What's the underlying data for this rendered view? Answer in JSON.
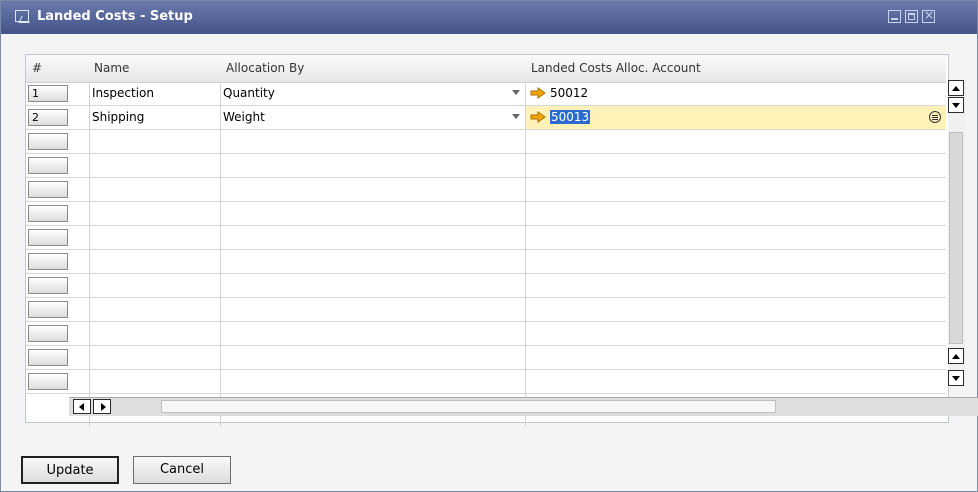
{
  "window": {
    "title": "Landed Costs - Setup"
  },
  "table": {
    "columns": [
      "#",
      "Name",
      "Allocation By",
      "Landed Costs Alloc. Account"
    ],
    "rows": [
      {
        "num": "1",
        "name": "Inspection",
        "allocation_by": "Quantity",
        "account": "50012"
      },
      {
        "num": "2",
        "name": "Shipping",
        "allocation_by": "Weight",
        "account": "50013"
      }
    ]
  },
  "buttons": {
    "update": "Update",
    "cancel": "Cancel"
  },
  "colors": {
    "titlebar": "#4b5f96",
    "selected_row": "#fff1b8",
    "selection": "#2c6ad0",
    "arrow": "#f2a500"
  }
}
